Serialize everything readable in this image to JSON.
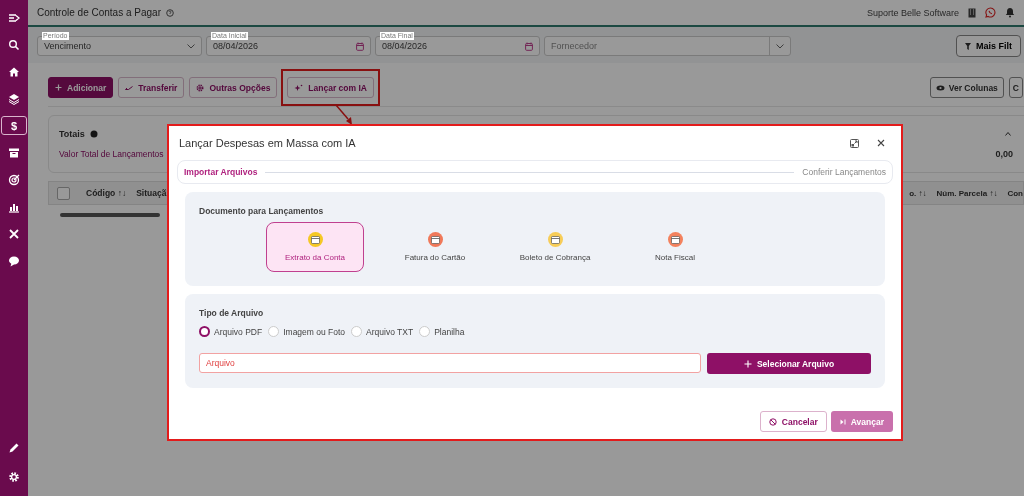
{
  "sidebar": {
    "items": [
      {
        "kind": "menu",
        "selected": false
      },
      {
        "kind": "search",
        "selected": false
      },
      {
        "kind": "home",
        "selected": false
      },
      {
        "kind": "layers",
        "selected": false
      },
      {
        "kind": "dollar",
        "glyph": "$",
        "selected": true
      },
      {
        "kind": "archive",
        "selected": false
      },
      {
        "kind": "target",
        "selected": false
      },
      {
        "kind": "chart",
        "selected": false
      },
      {
        "kind": "tools",
        "selected": false
      },
      {
        "kind": "chat",
        "selected": false
      }
    ],
    "bottom_items": [
      {
        "kind": "pencil",
        "selected": false
      },
      {
        "kind": "gear",
        "selected": false
      }
    ]
  },
  "header": {
    "title": "Controle de Contas a Pagar",
    "user": "Suporte Belle Software"
  },
  "filters": [
    {
      "kind": "select",
      "label": "Período",
      "value": "Vencimento"
    },
    {
      "kind": "date",
      "label": "Data Inicial",
      "value": "08/04/2026"
    },
    {
      "kind": "date",
      "label": "Data Final",
      "value": "08/04/2026"
    },
    {
      "kind": "combo",
      "placeholder": "Fornecedor"
    }
  ],
  "more_filters": "Mais Filt",
  "actions": [
    {
      "kind": "primary",
      "label": "Adicionar"
    },
    {
      "kind": "transfer",
      "label": "Transferir"
    },
    {
      "kind": "options",
      "label": "Outras Opções"
    },
    {
      "kind": "ai",
      "label": "Lançar com IA",
      "highlighted": true
    }
  ],
  "right_actions": [
    {
      "kind": "columns",
      "label": "Ver Colunas"
    },
    {
      "kind": "plain",
      "label": "C"
    }
  ],
  "totals": {
    "title": "Totais",
    "label": "Valor Total de Lançamentos",
    "value": "0,00"
  },
  "table": {
    "select_all_checked": false,
    "left_columns": [
      {
        "label": "Código",
        "sort": "↑↓"
      },
      {
        "label": "Situaçã"
      }
    ],
    "right_columns": [
      {
        "label": "o.",
        "sort": "↑↓"
      },
      {
        "label": "Núm. Parcela",
        "sort": "↑↓"
      },
      {
        "label": "Con"
      }
    ]
  },
  "modal": {
    "title": "Lançar Despesas em Massa com IA",
    "steps": [
      {
        "label": "Importar Arquivos",
        "selected": true
      },
      {
        "label": "Conferir Lançamentos",
        "selected": false
      }
    ],
    "document_title": "Documento para Lançamentos",
    "documents": [
      {
        "label": "Extrato da Conta",
        "selected": true,
        "color": "#f5c825"
      },
      {
        "label": "Fatura do Cartão",
        "selected": false,
        "color": "#f0795a"
      },
      {
        "label": "Boleto de Cobrança",
        "selected": false,
        "color": "#f7cd58"
      },
      {
        "label": "Nota Fiscal",
        "selected": false,
        "color": "#f3825e"
      }
    ],
    "file_type_title": "Tipo de Arquivo",
    "file_types": [
      {
        "label": "Arquivo PDF",
        "selected": true
      },
      {
        "label": "Imagem ou Foto",
        "selected": false
      },
      {
        "label": "Arquivo TXT",
        "selected": false
      },
      {
        "label": "Planilha",
        "selected": false
      }
    ],
    "file_field": {
      "placeholder": "Arquivo"
    },
    "select_button": "Selecionar Arquivo",
    "cancel_button": "Cancelar",
    "next_button": {
      "label": "Avançar",
      "disabled": true
    }
  }
}
